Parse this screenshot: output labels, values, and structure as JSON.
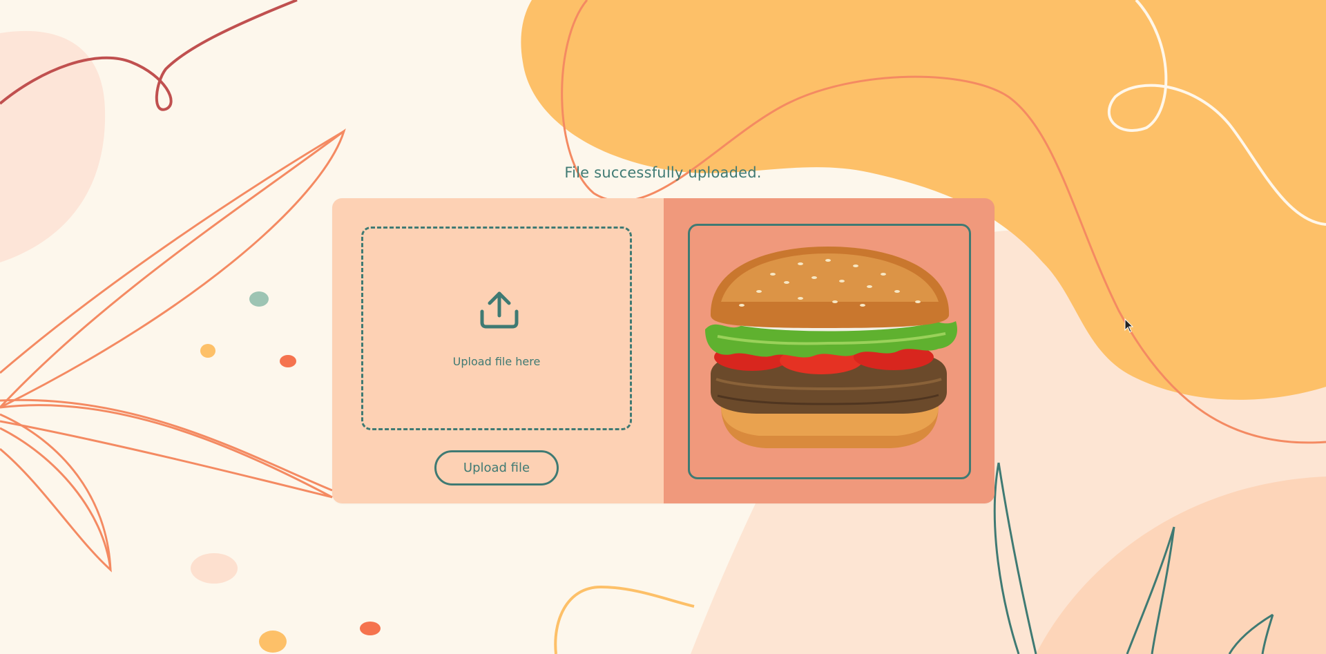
{
  "status": {
    "message": "File successfully uploaded."
  },
  "upload": {
    "dropzone_label": "Upload file here",
    "icon": "upload-icon",
    "button_label": "Upload file"
  },
  "preview": {
    "image": "hamburger"
  },
  "colors": {
    "background": "#fdf7ec",
    "accent": "#3f7a73",
    "left_panel": "#fdd1b4",
    "right_panel": "#f0997c",
    "blob_orange": "#fdc068",
    "line_coral": "#f48a62",
    "line_red": "#c0504f"
  }
}
